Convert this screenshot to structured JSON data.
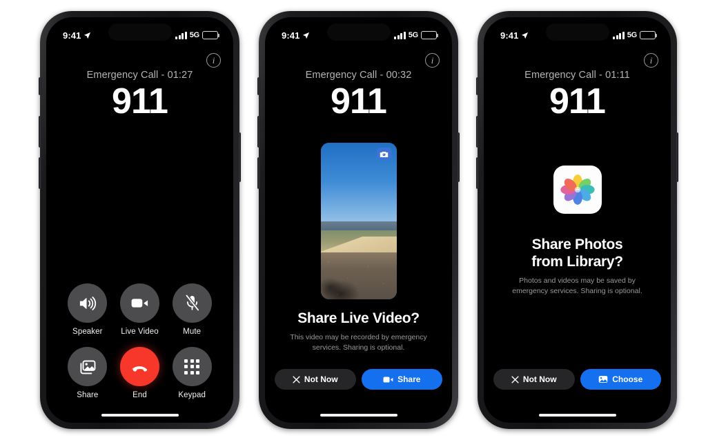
{
  "meta": {
    "scene": "iOS Emergency Call – Share Live Video and Photos flow",
    "accent_blue": "#1570ef",
    "end_call_red": "#f8372b",
    "control_gray": "#4c4c4e",
    "secondary_btn": "#262628"
  },
  "status_bar": {
    "time": "9:41",
    "location_icon": "location-arrow-icon",
    "signal_icon": "cellular-bars-icon",
    "network": "5G",
    "battery_icon": "battery-icon"
  },
  "phones": [
    {
      "id": "phone-call-controls",
      "info_button": "i",
      "call": {
        "status": "Emergency Call - 01:27",
        "number": "911"
      },
      "controls": [
        {
          "id": "speaker",
          "label": "Speaker",
          "icon": "speaker-wave-icon"
        },
        {
          "id": "live-video",
          "label": "Live Video",
          "icon": "video-camera-icon"
        },
        {
          "id": "mute",
          "label": "Mute",
          "icon": "microphone-slash-icon"
        },
        {
          "id": "share",
          "label": "Share",
          "icon": "share-photos-icon"
        },
        {
          "id": "end",
          "label": "End",
          "icon": "phone-down-icon"
        },
        {
          "id": "keypad",
          "label": "Keypad",
          "icon": "keypad-grid-icon"
        }
      ]
    },
    {
      "id": "phone-share-live-video",
      "info_button": "i",
      "call": {
        "status": "Emergency Call - 00:32",
        "number": "911"
      },
      "preview": {
        "type": "live-video-preview",
        "camera_flip_icon": "camera-rotate-icon"
      },
      "prompt": {
        "title": "Share Live Video?",
        "body": "This video may be recorded by emergency services. Sharing is optional."
      },
      "actions": [
        {
          "id": "not-now",
          "label": "Not Now",
          "icon": "close-x-icon",
          "style": "secondary"
        },
        {
          "id": "share",
          "label": "Share",
          "icon": "video-camera-icon",
          "style": "primary"
        }
      ]
    },
    {
      "id": "phone-share-photos",
      "info_button": "i",
      "call": {
        "status": "Emergency Call - 01:11",
        "number": "911"
      },
      "app_icon": "photos-app-icon",
      "prompt": {
        "title_line1": "Share Photos",
        "title_line2": "from Library?",
        "body": "Photos and videos may be saved by emergency services. Sharing is optional."
      },
      "actions": [
        {
          "id": "not-now",
          "label": "Not Now",
          "icon": "close-x-icon",
          "style": "secondary"
        },
        {
          "id": "choose",
          "label": "Choose",
          "icon": "photo-icon",
          "style": "primary"
        }
      ]
    }
  ]
}
